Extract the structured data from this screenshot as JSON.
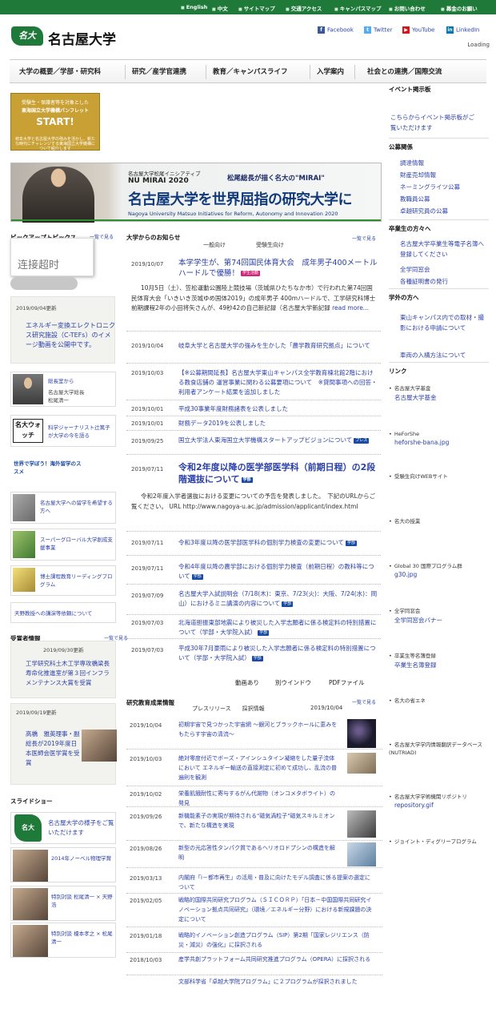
{
  "topbar": {
    "items": [
      "English",
      "中文",
      "サイトマップ",
      "交通アクセス",
      "キャンパスマップ",
      "お問い合わせ",
      "募金のお願い"
    ]
  },
  "logo": {
    "mark_text": "名大",
    "name": "名古屋大学"
  },
  "social": [
    {
      "icon": "facebook-icon",
      "label": "Facebook",
      "color": "#3b5998"
    },
    {
      "icon": "twitter-icon",
      "label": "Twitter",
      "color": "#55acee"
    },
    {
      "icon": "youtube-icon",
      "label": "YouTube",
      "color": "#cc181e"
    },
    {
      "icon": "linkedin-icon",
      "label": "LinkedIn",
      "color": "#0077b5"
    }
  ],
  "loading": "Loading",
  "nav": [
    "大学の概要／学部・研究科",
    "研究／産学官連携",
    "教育／キャンパスライフ",
    "入学案内",
    "社会との連携／国際交流"
  ],
  "pamphlet": {
    "line1": "受験生・保護者等を対象とした",
    "line2": "東海国立大学機構パンフレット",
    "line3": "START!",
    "line4": "岐阜大学と名古屋大学の強みを活かし、新たな時代にチャレンジする東海国立大学機構について紹介します"
  },
  "banner": {
    "subtitle": "名古屋大学松尾イニシアティブ",
    "name": "NU MIRAI 2020",
    "quote": "松尾総長が描く名大の\"MIRAI\"",
    "headline": "名古屋大学を世界屈指の研究大学に",
    "english": "Nagoya University Matsuo Initiatives for Reform, Autonomy and Innovation 2020"
  },
  "left": {
    "topics_head": "ピックアップトピックス",
    "more": "一覧で見る",
    "error_text": "连接超时",
    "topic_date": "2019/09/04更新",
    "topic_text": "エネルギー変換エレクトロニクス研究施設（C-TEFs）のイメージ動画を公開中です。",
    "links": [
      {
        "title": "総長室から",
        "sub1": "名古屋大学総長",
        "sub2": "松尾清一"
      },
      {
        "title": "科学ジャーナリスト辻篤子が大学の今を語る",
        "badge": "名大ウォッチ"
      },
      {
        "title": "世界で学ぼう！海外留学のススメ"
      },
      {
        "title": "名古屋大学への留学を希望する方へ"
      },
      {
        "title": "スーパーグローバル大学創成支援事業"
      },
      {
        "title": "博士課程教育リーディングプログラム"
      },
      {
        "title": "天野教授への講演等依頼について"
      }
    ],
    "awards_head": "受賞者情報",
    "awards_more": "一覧で見る",
    "award1_date": "2019/09/30更新",
    "award1_text": "工学研究科土木工学専攻橋梁長寿命化推進室が第３回インフラメンテナンス大賞を受賞",
    "award2_date": "2019/09/19更新",
    "award2_text": "高橋　雅英理事・副総長が2019年度日本医師会医学賞を受賞",
    "slideshow_head": "スライドショー",
    "slides": [
      "名古屋大学の様子をご覧いただけます",
      "2014年ノーベル物理学賞",
      "特別対談 松尾清一 × 天野 浩",
      "特別対談 榎本孝之 × 松尾清一"
    ]
  },
  "announcements": {
    "head": "大学からのお知らせ",
    "more": "一覧で見る",
    "tabs": [
      "一般向け",
      "受験生向け"
    ],
    "items": [
      {
        "date": "2019/10/07",
        "title": "本学学生が、第74回国民体育大会　成年男子400メートルハードルで優勝！",
        "badge": "学生活動",
        "excerpt": "10月5日（土）、笠松運動公園陸上競技場（茨城県ひたちなか市）で行われた第74回国民体育大会「いきいき茨城ゆめ国体2019」の成年男子 400mハードルで、工学研究科博士前期課程2年の小田将矢さんが、49秒42の自己新記録（名古屋大学新記録",
        "read_more": "read more..."
      },
      {
        "date": "2019/10/04",
        "title": "岐阜大学と名古屋大学の強みを生かした「農学教育研究拠点」について"
      },
      {
        "date": "2019/10/03",
        "title": "【※公募期間延長】名古屋大学東山キャンパス全学教育棟北館2階における教食店舗の 運営事業に関わる公募要項について　※貸間事項への回答・利用者アンケート結果を追加しました"
      },
      {
        "date": "2019/10/01",
        "title": "平成30事業年度財務諸表を公表しました"
      },
      {
        "date": "2019/10/01",
        "title": "財務データ2019を公表しました"
      },
      {
        "date": "2019/09/25",
        "title": "国立大学法人東海国立大学機構スタートアップビジョンについて",
        "badge": "プレス"
      },
      {
        "date": "2019/07/11",
        "title": "令和2年度以降の医学部医学科（前期日程）の2段階選抜について",
        "badge": "学部",
        "excerpt": "令和2年度入学者選抜における変更についての予告を発表しました。　下記のURLからご覧ください。 URL http://www.nagoya-u.ac.jp/admission/applicant/index.html"
      },
      {
        "date": "2019/07/11",
        "title": "令和3年度以降の医学部医学科の個別学力検査の変更について",
        "badge": "学部"
      },
      {
        "date": "2019/07/11",
        "title": "令和4年度以降の農学部における個別学力検査（前期日程）の教科等について",
        "badge": "学部"
      },
      {
        "date": "2019/07/09",
        "title": "名古屋大学入試説明会（7/18(木)：東京、7/23(火)：大阪、7/24(水)：岡山）におけるミニ講演の内容について",
        "badge": "学部"
      },
      {
        "date": "2019/07/03",
        "title": "北海道胆振東部地震により被災した入学志願者に係る検定料の特別措置について（学部・大学院入試）",
        "badge": "学部"
      },
      {
        "date": "2019/07/03",
        "title": "平成30年7月豪雨により被災した入学志願者に係る検定料の特別措置について（学部・大学院入試）",
        "badge": "学部"
      }
    ],
    "legend": [
      "動画あり",
      "別ウインドウ",
      "PDFファイル"
    ]
  },
  "research": {
    "head": "研究教育成果情報",
    "more": "一覧で見る",
    "tabs": "プレスリリース　　採択情報",
    "date_label": "2019/10/04",
    "items": [
      {
        "date": "2019/10/04",
        "title": "初期宇宙で見つかった宇宙網 ～銀河とブラックホールに恵みをもたらす宇宙の清流～"
      },
      {
        "date": "2019/10/03",
        "title": "絶対零度付近でボーズ・アインシュタイン凝縮をした量子流体において エネルギー輸送の直接測定に初めて成功し、乱流の普遍則を観測"
      },
      {
        "date": "2019/10/02",
        "title": "栄養飢餓耐性に寄与するがん代謝物（オンコメタボライト）の発見"
      },
      {
        "date": "2019/09/26",
        "title": "新機能素子の実現が期待される\"磁気渦粒子\"磁気スキルミオンで、新たな構造を実現"
      },
      {
        "date": "2019/08/26",
        "title": "新型の光応答性タンパク質であるヘリオロドプシンの構造を解明"
      },
      {
        "date": "2019/03/13",
        "title": "内閣府「i－都市再生」の活用・普及に向けたモデル調査に係る提案の選定について"
      },
      {
        "date": "2019/02/05",
        "title": "戦略的国際共同研究プログラム（ＳＩＣＯＲＰ）「日本－中国国際共同研究イノベーション拠点共同研究」（環境／エネルギー分野）における新規課題の決定について"
      },
      {
        "date": "2019/01/18",
        "title": "戦略的イノベーション創造プログラム（SIP）第2期「国家レジリエンス（防災・減災）の強化」に採択される"
      },
      {
        "date": "2018/10/03",
        "title": "産学共創プラットフォーム共同研究推進プログラム（OPERA）に採択される"
      },
      {
        "date": "",
        "title": "文部科学省「卓越大学院プログラム」に２プログラムが採択されました"
      }
    ]
  },
  "right": {
    "event_head": "イベント掲示板",
    "event_link": "こちらからイベント掲示板がご覧いただけます",
    "public_head": "公募関係",
    "public_links": [
      "調達情報",
      "財産売却情報",
      "ネーミングライツ公募",
      "教職員公募",
      "卓越研究員の公募"
    ],
    "grad_head": "卒業生の方々へ",
    "grad_links": [
      "名古屋大学卒業生等電子名簿へ登録してください",
      "全学同窓会",
      "各種証明書の発行"
    ],
    "outside_head": "学外の方へ",
    "outside_links": [
      "東山キャンパス内での取材・撮影における申請について",
      "車両の入構方法について"
    ],
    "links_head": "リンク",
    "links": [
      {
        "caption": "名古屋大学基金",
        "link": "名古屋大学基金"
      },
      {
        "caption": "HeForShe",
        "link": "heforshe-bana.jpg"
      },
      {
        "caption": "受験生向けWEBサイト",
        "link": ""
      },
      {
        "caption": "名大の授業",
        "link": ""
      },
      {
        "caption": "Global 30 国際プログラム群",
        "link": "g30.jpg"
      },
      {
        "caption": "全学同窓会",
        "link": "全学同窓会バナー"
      },
      {
        "caption": "卒業生等名簿登録",
        "link": "卒業生名簿登録"
      },
      {
        "caption": "名大の省エネ",
        "link": ""
      },
      {
        "caption": "名古屋大学学内情報翻訳データベース(NUTRIAD)",
        "link": ""
      },
      {
        "caption": "名古屋大学学術機関リポジトリ",
        "link": "repository.gif"
      },
      {
        "caption": "ジョイント・ディグリープログラム",
        "link": ""
      }
    ]
  }
}
